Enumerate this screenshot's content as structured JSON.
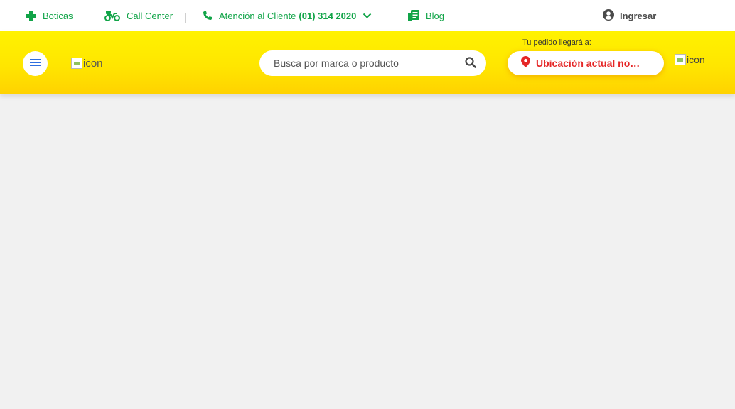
{
  "topbar": {
    "items": [
      {
        "label": "Boticas",
        "icon": "plus-icon"
      },
      {
        "label": "Call Center",
        "icon": "motorbike-icon"
      },
      {
        "label": "Atención al Cliente",
        "bold": "(01) 314 2020",
        "icon": "phone-icon"
      },
      {
        "label": "Blog",
        "icon": "blog-icon"
      }
    ],
    "login_label": "Ingresar"
  },
  "header": {
    "logo_alt": "icon",
    "search_placeholder": "Busca por marca o producto",
    "deliver_label": "Tu pedido llegará a:",
    "location_text": "Ubicación actual no disponible",
    "cart_alt": "icon"
  },
  "colors": {
    "brand_green": "#11a448",
    "header_yellow": "#ffe600",
    "location_red": "#e52727",
    "menu_blue": "#2f6fe0"
  }
}
